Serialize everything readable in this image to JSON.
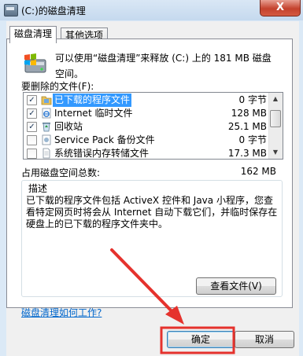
{
  "window": {
    "title": "(C:)的磁盘清理",
    "close_glyph": "X"
  },
  "tabs": [
    {
      "label": "磁盘清理",
      "active": true
    },
    {
      "label": "其他选项",
      "active": false
    }
  ],
  "intro_text": "可以使用“磁盘清理”来释放 (C:) 上的 181 MB 磁盘空间。",
  "files_label": "要删除的文件(F):",
  "files": [
    {
      "name": "已下载的程序文件",
      "size": "0 字节",
      "checked": true,
      "selected": true,
      "icon": "folder-icon"
    },
    {
      "name": "Internet 临时文件",
      "size": "128 MB",
      "checked": true,
      "selected": false,
      "icon": "ie-temp-icon"
    },
    {
      "name": "回收站",
      "size": "25.1 MB",
      "checked": true,
      "selected": false,
      "icon": "recycle-bin-icon"
    },
    {
      "name": "Service Pack 备份文件",
      "size": "0 字节",
      "checked": false,
      "selected": false,
      "icon": "backup-icon"
    },
    {
      "name": "系统错误内存转储文件",
      "size": "17.3 MB",
      "checked": false,
      "selected": false,
      "icon": "document-icon"
    }
  ],
  "total_label": "占用磁盘空间总数:",
  "total_value": "162 MB",
  "description_title": "描述",
  "description_text": "已下载的程序文件包括 ActiveX 控件和 Java 小程序，您查看特定网页时将会从 Internet 自动下载它们，并临时保存在硬盘上的已下载的程序文件夹中。",
  "view_files_button": "查看文件(V)",
  "help_link": "磁盘清理如何工作?",
  "ok_button": "确定",
  "cancel_button": "取消",
  "colors": {
    "selection": "#3399ff",
    "link": "#0066cc",
    "annotation": "#e5322d"
  }
}
